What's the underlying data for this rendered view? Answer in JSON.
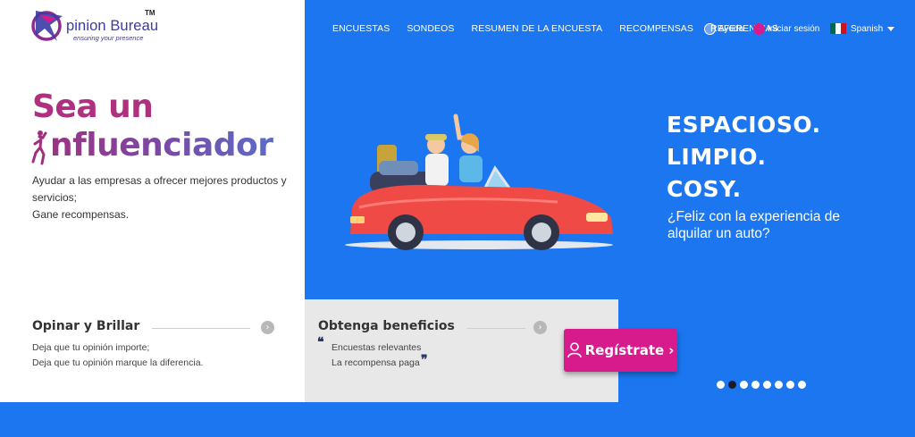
{
  "logo": {
    "text": "pinion Bureau",
    "tm": "TM",
    "tagline": "ensuring your presence"
  },
  "nav": {
    "items": [
      "ENCUESTAS",
      "SONDEOS",
      "RESUMEN DE LA ENCUESTA",
      "RECOMPENSAS",
      "REFERENCIAS"
    ],
    "help": "Ayuda",
    "login": "Iniciar sesión",
    "language": "Spanish"
  },
  "hero": {
    "headline_line1": "Sea un",
    "headline_line2": "nfluenciador",
    "lead_lines": [
      "Ayudar a las empresas a ofrecer mejores productos y servicios;",
      "Gane recompensas."
    ]
  },
  "info_left": {
    "title": "Opinar y Brillar",
    "lines": [
      "Deja que tu opinión importe;",
      "Deja que tu opinión marque la diferencia."
    ]
  },
  "info_right": {
    "title": "Obtenga beneficios",
    "lines": [
      "Encuestas relevantes",
      "La recompensa paga"
    ]
  },
  "register_button": "Regístrate",
  "promo": {
    "lines": [
      "ESPACIOSO.",
      "LIMPIO.",
      "COSY."
    ],
    "sub": "¿Feliz con la experiencia de alquilar un auto?"
  },
  "carousel": {
    "count": 8,
    "active_index": 1
  },
  "colors": {
    "hero_blue": "#1b76f0",
    "accent_pink": "#d81b8c",
    "headline_magenta": "#b03080"
  }
}
